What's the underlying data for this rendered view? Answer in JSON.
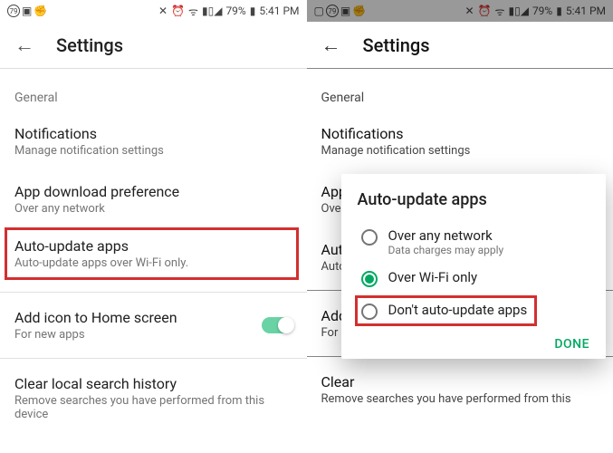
{
  "status": {
    "battery": "79%",
    "time": "5:41 PM",
    "left_badge": "79"
  },
  "appbar": {
    "title": "Settings"
  },
  "section": {
    "general": "General"
  },
  "rows": {
    "notifications": {
      "title": "Notifications",
      "sub": "Manage notification settings"
    },
    "download": {
      "title": "App download preference",
      "sub": "Over any network"
    },
    "autoupdate": {
      "title": "Auto-update apps",
      "sub": "Auto-update apps over Wi-Fi only."
    },
    "addicon": {
      "title": "Add icon to Home screen",
      "sub": "For new apps"
    },
    "clear": {
      "title": "Clear local search history",
      "sub": "Remove searches you have performed from this device"
    }
  },
  "rows2": {
    "download_title": "App d",
    "download_sub": "Over a",
    "autoupdate_title": "Auto-",
    "autoupdate_sub": "Auto-",
    "addicon_title": "Add i",
    "addicon_sub": "For ne",
    "clear_title": "Clear",
    "clear_sub": "Remove searches you have performed from this"
  },
  "dialog": {
    "title": "Auto-update apps",
    "opt1": {
      "label": "Over any network",
      "sub": "Data charges may apply"
    },
    "opt2": {
      "label": "Over Wi-Fi only"
    },
    "opt3": {
      "label": "Don't auto-update apps"
    },
    "done": "DONE"
  }
}
